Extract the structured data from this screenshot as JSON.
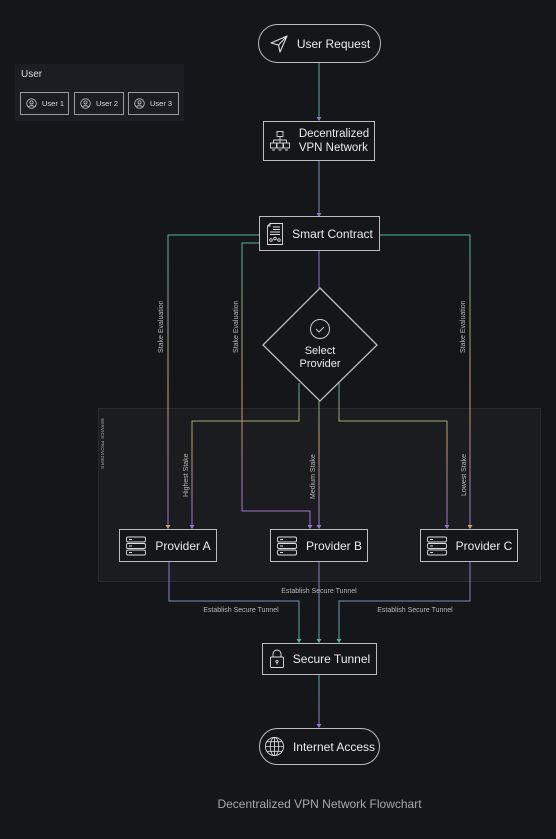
{
  "title": "Decentralized VPN Network Flowchart",
  "user_panel": {
    "title": "User",
    "users": [
      "User 1",
      "User 2",
      "User 3"
    ],
    "icon": "user-circle-icon"
  },
  "nodes": {
    "user_request": {
      "label": "User Request",
      "icon": "send-icon"
    },
    "vpn_network": {
      "label_line1": "Decentralized",
      "label_line2": "VPN Network",
      "icon": "network-icon"
    },
    "smart_contract": {
      "label": "Smart Contract",
      "icon": "contract-icon"
    },
    "select_provider": {
      "label_line1": "Select",
      "label_line2": "Provider",
      "icon": "check-circle-icon"
    },
    "provider_a": {
      "label": "Provider A",
      "icon": "server-icon"
    },
    "provider_b": {
      "label": "Provider B",
      "icon": "server-icon"
    },
    "provider_c": {
      "label": "Provider C",
      "icon": "server-icon"
    },
    "secure_tunnel": {
      "label": "Secure Tunnel",
      "icon": "lock-icon"
    },
    "internet_access": {
      "label": "Internet Access",
      "icon": "globe-icon"
    }
  },
  "group": {
    "label": "SERVICE PROVIDERS"
  },
  "edge_labels": {
    "stake_eval": "Stake Evaluation",
    "highest": "Highest Stake",
    "medium": "Medium Stake",
    "lowest": "Lowest Stake",
    "tunnel": "Establish Secure Tunnel"
  },
  "colors": {
    "background": "#15161a",
    "teal": "#4fb3a0",
    "orange": "#c9a262",
    "purple": "#9b6fd6"
  }
}
